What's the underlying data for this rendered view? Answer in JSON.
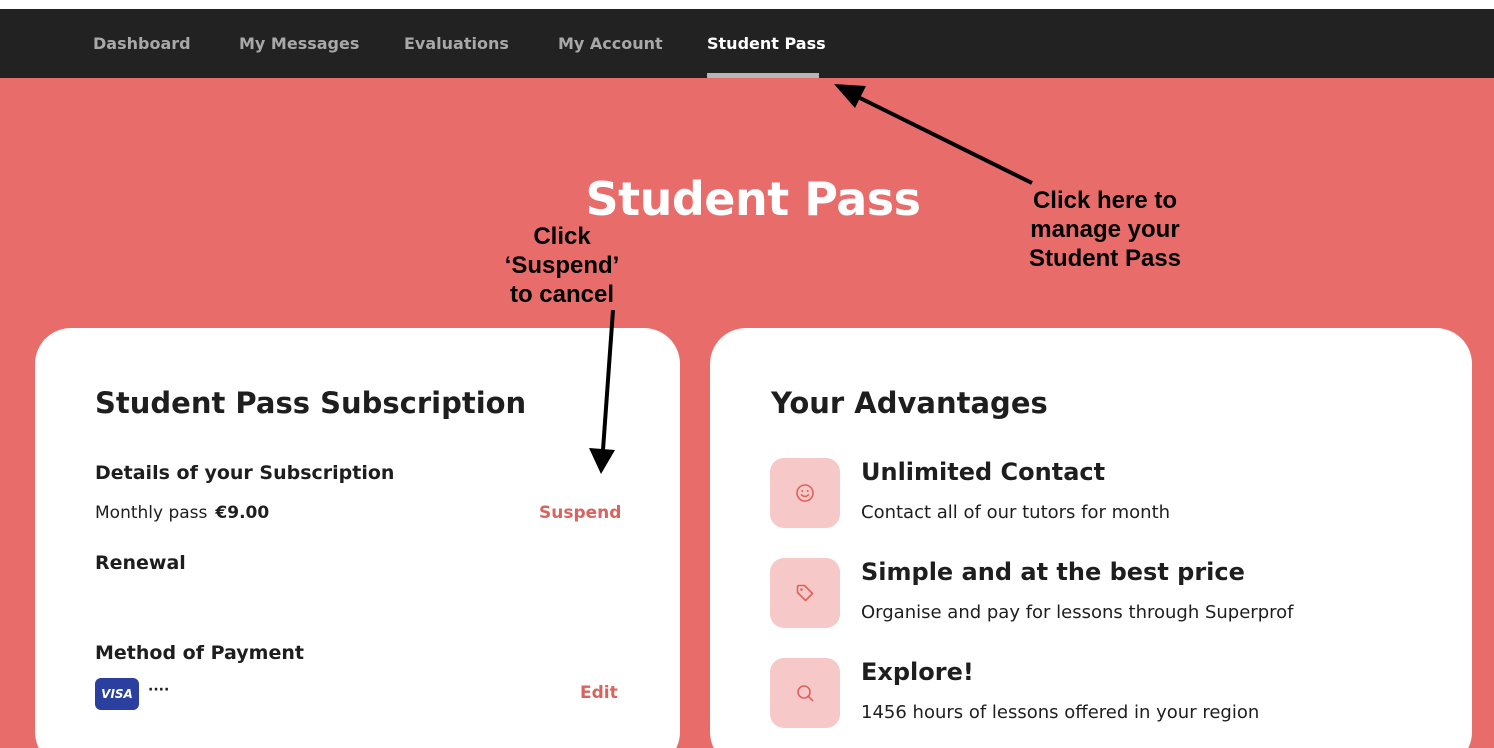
{
  "nav": {
    "items": [
      {
        "label": "Dashboard",
        "active": false
      },
      {
        "label": "My Messages",
        "active": false
      },
      {
        "label": "Evaluations",
        "active": false
      },
      {
        "label": "My Account",
        "active": false
      },
      {
        "label": "Student Pass",
        "active": true
      }
    ]
  },
  "page": {
    "title": "Student Pass"
  },
  "annotations": {
    "nav_note": [
      "Click here to",
      "manage your",
      "Student Pass"
    ],
    "suspend_note": [
      "Click",
      "‘Suspend’",
      "to cancel"
    ]
  },
  "subscription": {
    "title": "Student Pass Subscription",
    "details_heading": "Details of your Subscription",
    "plan_name": "Monthly pass",
    "plan_price": "€9.00",
    "suspend_label": "Suspend",
    "renewal_heading": "Renewal",
    "payment_heading": "Method of Payment",
    "card_brand": "VISA",
    "card_masked": "····",
    "edit_label": "Edit"
  },
  "advantages": {
    "title": "Your Advantages",
    "items": [
      {
        "icon": "smiley-icon",
        "title": "Unlimited Contact",
        "description": "Contact all of our tutors for month"
      },
      {
        "icon": "tag-icon",
        "title": "Simple and at the best price",
        "description": "Organise and pay for lessons through Superprof"
      },
      {
        "icon": "search-icon",
        "title": "Explore!",
        "description": "1456 hours of lessons offered in your region"
      }
    ]
  },
  "colors": {
    "background": "#e86c6a",
    "navbar": "#222222",
    "accent_link": "#d9645f",
    "icon_tile": "#f6c8c8",
    "visa": "#2a3f9e"
  }
}
